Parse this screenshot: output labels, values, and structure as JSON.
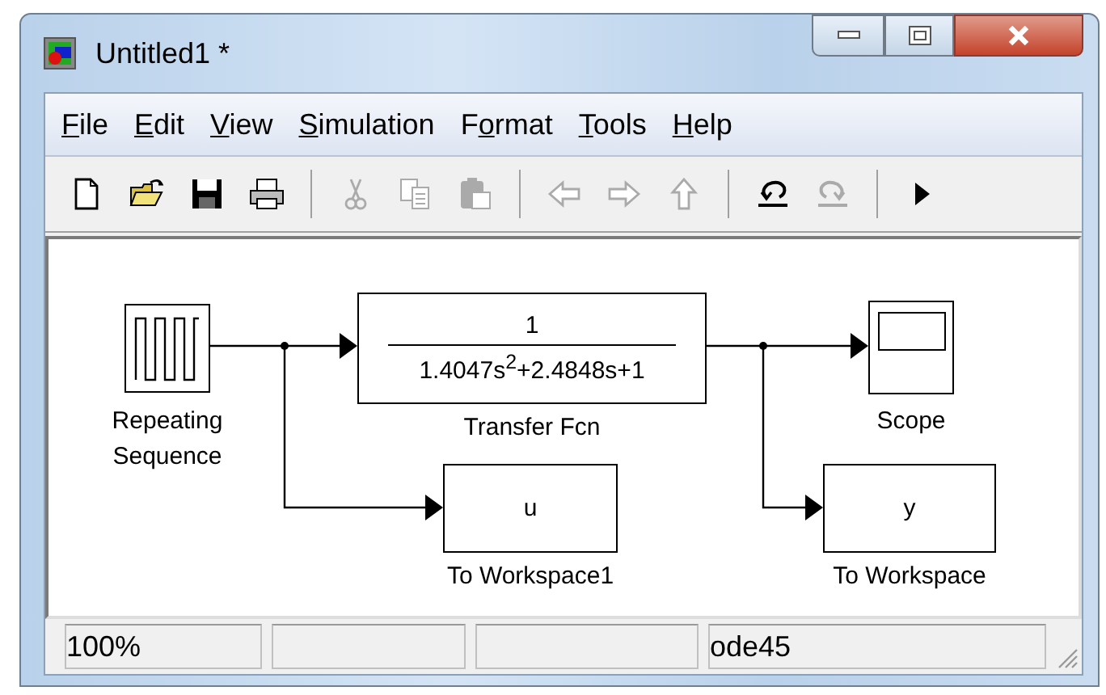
{
  "window": {
    "title": "Untitled1 *"
  },
  "menus": [
    {
      "key": "F",
      "rest": "ile"
    },
    {
      "key": "E",
      "rest": "dit"
    },
    {
      "key": "V",
      "rest": "iew"
    },
    {
      "key": "S",
      "rest": "imulation"
    },
    {
      "before": "F",
      "key": "o",
      "rest": "rmat"
    },
    {
      "key": "T",
      "rest": "ools"
    },
    {
      "key": "H",
      "rest": "elp"
    }
  ],
  "toolbar": [
    [
      {
        "kind": "new",
        "disabled": false
      },
      {
        "kind": "open",
        "disabled": false
      },
      {
        "kind": "save",
        "disabled": false
      },
      {
        "kind": "print",
        "disabled": false
      }
    ],
    [
      {
        "kind": "cut",
        "disabled": true
      },
      {
        "kind": "copy",
        "disabled": true
      },
      {
        "kind": "paste",
        "disabled": true
      }
    ],
    [
      {
        "kind": "back",
        "disabled": true
      },
      {
        "kind": "forward",
        "disabled": true
      },
      {
        "kind": "up",
        "disabled": true
      }
    ],
    [
      {
        "kind": "undo",
        "disabled": false
      },
      {
        "kind": "redo",
        "disabled": true
      }
    ],
    [
      {
        "kind": "run",
        "disabled": false
      }
    ]
  ],
  "blocks": [
    {
      "kind": "repeating_sequence",
      "label": "Repeating Sequence"
    },
    {
      "kind": "transfer_fcn",
      "label": "Transfer Fcn",
      "numerator": "1",
      "denominator": "1.4047s$^{2}$+2.4848s+1"
    },
    {
      "kind": "scope",
      "label": "Scope"
    },
    {
      "kind": "to_workspace",
      "label": "To Workspace1",
      "variable": "u"
    },
    {
      "kind": "to_workspace",
      "label": "To Workspace",
      "variable": "y"
    }
  ],
  "status_bar": {
    "zoom": "100%",
    "solver": "ode45"
  }
}
